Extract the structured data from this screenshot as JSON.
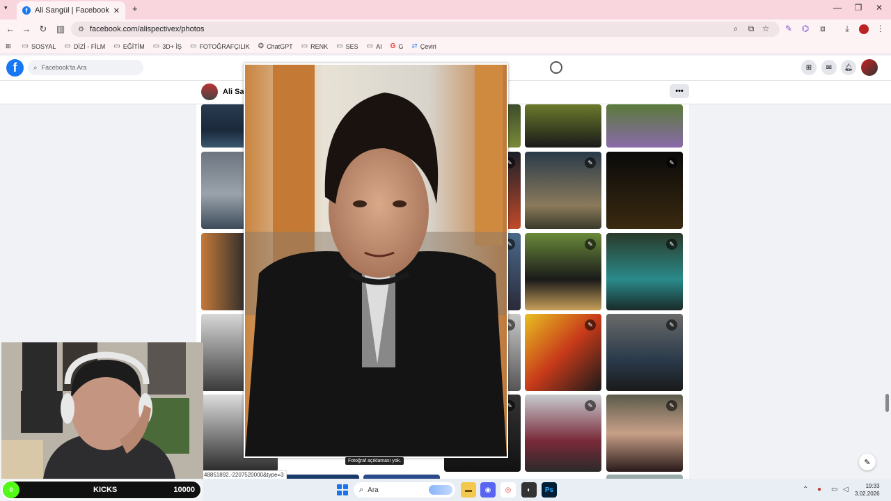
{
  "browser": {
    "tab_title": "Ali Sangül | Facebook",
    "tab_close": "✕",
    "new_tab": "+",
    "url": "facebook.com/alispectivex/photos",
    "window_controls": [
      "—",
      "❐",
      "✕"
    ],
    "bookmarks": [
      {
        "label": "SOSYAL",
        "icon": "folder-icon"
      },
      {
        "label": "DİZİ - FİLM",
        "icon": "folder-icon"
      },
      {
        "label": "EĞİTİM",
        "icon": "folder-icon"
      },
      {
        "label": "3D+ İŞ",
        "icon": "folder-icon"
      },
      {
        "label": "FOTOĞRAFÇILIK",
        "icon": "folder-icon"
      },
      {
        "label": "ChatGPT",
        "icon": "chatgpt-icon"
      },
      {
        "label": "RENK",
        "icon": "folder-icon"
      },
      {
        "label": "SES",
        "icon": "folder-icon"
      },
      {
        "label": "AI",
        "icon": "folder-icon"
      },
      {
        "label": "G",
        "icon": "google-icon"
      },
      {
        "label": "Çeviri",
        "icon": "translate-icon"
      }
    ]
  },
  "facebook": {
    "logo": "f",
    "search_placeholder": "Facebook'ta Ara",
    "profile_name": "Ali Sang",
    "more_button": "•••"
  },
  "preview": {
    "tooltip": "Fotoğraf açıklaması yok.",
    "status_url": "48851892.-2207520000&type=3"
  },
  "overlay": {
    "kicks_count": "0",
    "kicks_label": "KICKS",
    "kicks_goal": "10000"
  },
  "taskbar": {
    "search_placeholder": "Ara",
    "time": "19:33",
    "date": "3.02.2026"
  },
  "colors": {
    "facebook_blue": "#1877f2",
    "tab_strip": "#f9d6dd",
    "kicks_green": "#53fc18"
  }
}
